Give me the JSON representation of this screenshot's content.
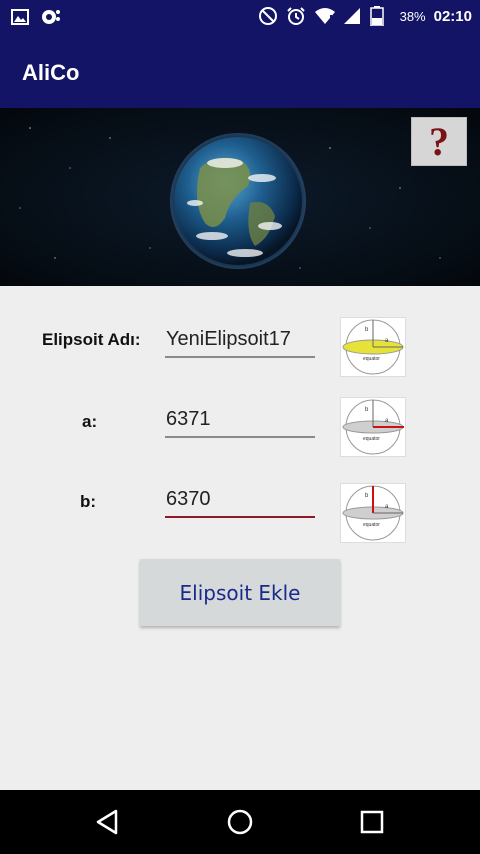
{
  "status_bar": {
    "left_icons": [
      "image-icon",
      "sync-icon"
    ],
    "right_icons": [
      "do-not-disturb-icon",
      "alarm-icon",
      "wifi-icon",
      "signal-icon",
      "battery-icon"
    ],
    "battery": "38%",
    "time": "02:10"
  },
  "app_bar": {
    "title": "AliCo"
  },
  "banner": {
    "image": "earth-image",
    "help_label": "?"
  },
  "form": {
    "name_label": "Elipsoit Adı:",
    "name_value": "YeniElipsoit17",
    "a_label": "a:",
    "a_value": "6371",
    "b_label": "b:",
    "b_value": "6370",
    "diagram_text": "equator",
    "diagram_b": "b",
    "diagram_a": "a"
  },
  "add_button": {
    "label": "Elipsoit Ekle"
  },
  "nav_bar": {
    "buttons": [
      "back-icon",
      "home-icon",
      "recents-icon"
    ]
  },
  "colors": {
    "primary": "#141466",
    "active_underline": "#8b1a2b",
    "button_text": "#1a2a8a",
    "help_mark": "#7a1414"
  }
}
